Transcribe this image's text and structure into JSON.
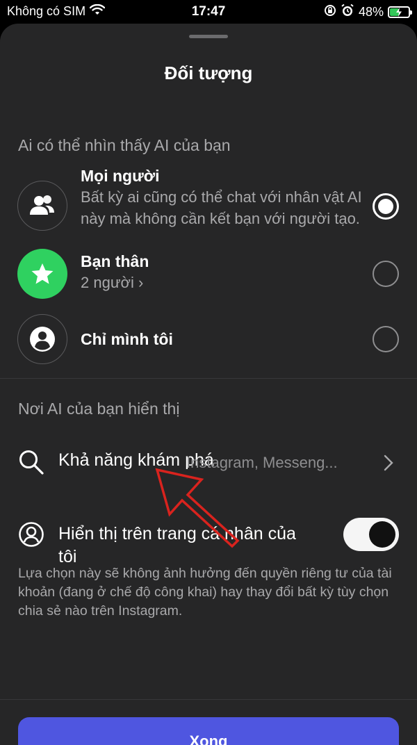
{
  "status_bar": {
    "carrier": "Không có SIM",
    "time": "17:47",
    "battery_percent": "48%",
    "battery_color": "#34c759"
  },
  "sheet": {
    "title": "Đối tượng"
  },
  "visibility_section": {
    "label": "Ai có thể nhìn thấy AI của bạn",
    "options": [
      {
        "title": "Mọi người",
        "subtitle": "Bất kỳ ai cũng có thể chat với nhân vật AI này mà không cần kết bạn với người tạo.",
        "icon": "people-icon",
        "selected": true
      },
      {
        "title": "Bạn thân",
        "subtitle": "2 người ›",
        "icon": "star-icon",
        "icon_bg": "#2fd160",
        "selected": false
      },
      {
        "title": "Chỉ mình tôi",
        "icon": "person-icon",
        "selected": false
      }
    ]
  },
  "display_section": {
    "label": "Nơi AI của bạn hiển thị",
    "discovery": {
      "title": "Khả năng khám phá",
      "value": "Instagram, Messeng...",
      "icon": "search-icon"
    },
    "profile": {
      "title": "Hiển thị trên trang cá nhân của tôi",
      "icon": "profile-icon",
      "toggle_on": true
    },
    "note": "Lựa chọn này sẽ không ảnh hưởng đến quyền riêng tư của tài khoản (đang ở chế độ công khai) hay thay đổi bất kỳ tùy chọn chia sẻ nào trên Instagram."
  },
  "footer": {
    "delete_label": "Xong",
    "button_color": "#4f56e0"
  },
  "annotation": {
    "arrow_color": "#d9231e"
  }
}
